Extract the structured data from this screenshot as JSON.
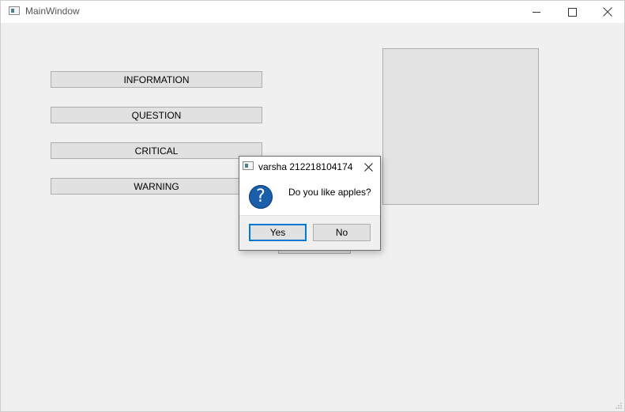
{
  "window": {
    "title": "MainWindow",
    "minimize_icon": "minimize-icon",
    "maximize_icon": "maximize-icon",
    "close_icon": "close-icon"
  },
  "buttons": {
    "information": "INFORMATION",
    "question": "QUESTION",
    "critical": "CRITICAL",
    "warning": "WARNING"
  },
  "dialog": {
    "title": "varsha 212218104174",
    "message": "Do you like apples?",
    "icon": "question-icon",
    "icon_glyph": "?",
    "yes_label": "Yes",
    "no_label": "No",
    "accent": "#0078d7",
    "icon_color": "#1b5fab"
  }
}
